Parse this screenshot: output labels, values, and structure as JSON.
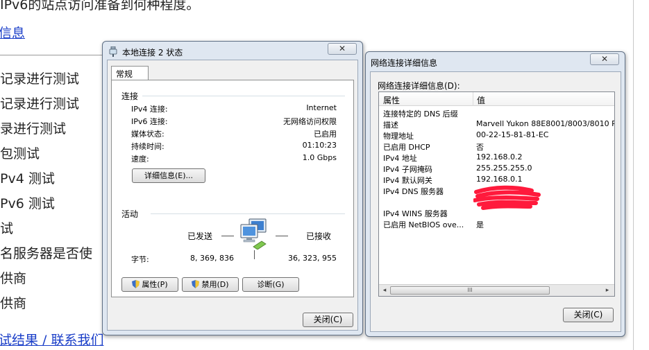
{
  "background": {
    "top_text": "IPv6的站点访问准备到何种程度。",
    "link_info": "信息",
    "items": [
      "记录进行测试",
      "记录进行测试",
      "录进行测试",
      "包测试",
      "Pv4 测试",
      "Pv6 测试",
      "试",
      "名服务器是否使",
      "供商",
      "供商"
    ],
    "footer_link": "试结果 / 联系我们"
  },
  "dialog1": {
    "title": "本地连接 2 状态",
    "close": "✕",
    "tab": "常规",
    "connection": {
      "heading": "连接",
      "rows": [
        {
          "label": "IPv4 连接:",
          "value": "Internet"
        },
        {
          "label": "IPv6 连接:",
          "value": "无网络访问权限"
        },
        {
          "label": "媒体状态:",
          "value": "已启用"
        },
        {
          "label": "持续时间:",
          "value": "01:10:23"
        },
        {
          "label": "速度:",
          "value": "1.0 Gbps"
        }
      ],
      "details_button": "详细信息(E)..."
    },
    "activity": {
      "heading": "活动",
      "sent_label": "已发送",
      "received_label": "已接收",
      "bytes_label": "字节:",
      "bytes_sent": "8, 369, 836",
      "bytes_received": "36, 323, 955"
    },
    "buttons": {
      "properties": "属性(P)",
      "disable": "禁用(D)",
      "diagnose": "诊断(G)",
      "close": "关闭(C)"
    }
  },
  "dialog2": {
    "title": "网络连接详细信息",
    "close": "✕",
    "list_label": "网络连接详细信息(D):",
    "columns": [
      "属性",
      "值"
    ],
    "rows": [
      {
        "prop": "连接特定的 DNS 后缀",
        "value": ""
      },
      {
        "prop": "描述",
        "value": "Marvell Yukon 88E8001/8003/8010 P"
      },
      {
        "prop": "物理地址",
        "value": "00-22-15-81-81-EC"
      },
      {
        "prop": "已启用 DHCP",
        "value": "否"
      },
      {
        "prop": "IPv4 地址",
        "value": "192.168.0.2"
      },
      {
        "prop": "IPv4 子网掩码",
        "value": "255.255.255.0"
      },
      {
        "prop": "IPv4 默认网关",
        "value": "192.168.0.1"
      },
      {
        "prop": "IPv4 DNS 服务器",
        "value": ""
      },
      {
        "prop": "",
        "value": ""
      },
      {
        "prop": "IPv4 WINS 服务器",
        "value": ""
      },
      {
        "prop": "已启用 NetBIOS ove...",
        "value": "是"
      }
    ],
    "scroll_thumb": "III",
    "scroll_left": "◂",
    "scroll_right": "▸",
    "close_button": "关闭(C)",
    "redaction_color": "#ff1a3c"
  }
}
